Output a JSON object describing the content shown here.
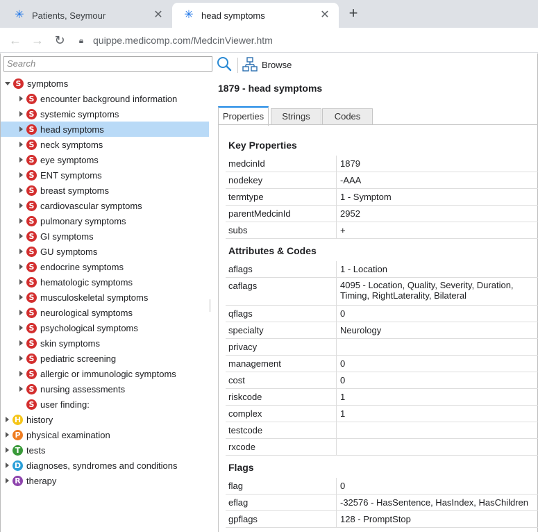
{
  "browser": {
    "tabs": [
      {
        "title": "Patients, Seymour",
        "icon": "medicomp-icon"
      },
      {
        "title": "head symptoms",
        "icon": "medicomp-icon"
      }
    ],
    "url": "quippe.medicomp.com/MedcinViewer.htm"
  },
  "search": {
    "placeholder": "Search"
  },
  "toolbar": {
    "browse_label": "Browse"
  },
  "tree": [
    {
      "label": "symptoms",
      "badge": "S",
      "color": "#d32f2f",
      "level": 0,
      "toggle": "down"
    },
    {
      "label": "encounter background information",
      "badge": "S",
      "color": "#d32f2f",
      "level": 1,
      "toggle": "right"
    },
    {
      "label": "systemic symptoms",
      "badge": "S",
      "color": "#d32f2f",
      "level": 1,
      "toggle": "right"
    },
    {
      "label": "head symptoms",
      "badge": "S",
      "color": "#d32f2f",
      "level": 1,
      "toggle": "right",
      "selected": true
    },
    {
      "label": "neck symptoms",
      "badge": "S",
      "color": "#d32f2f",
      "level": 1,
      "toggle": "right"
    },
    {
      "label": "eye symptoms",
      "badge": "S",
      "color": "#d32f2f",
      "level": 1,
      "toggle": "right"
    },
    {
      "label": "ENT symptoms",
      "badge": "S",
      "color": "#d32f2f",
      "level": 1,
      "toggle": "right"
    },
    {
      "label": "breast symptoms",
      "badge": "S",
      "color": "#d32f2f",
      "level": 1,
      "toggle": "right"
    },
    {
      "label": "cardiovascular symptoms",
      "badge": "S",
      "color": "#d32f2f",
      "level": 1,
      "toggle": "right"
    },
    {
      "label": "pulmonary symptoms",
      "badge": "S",
      "color": "#d32f2f",
      "level": 1,
      "toggle": "right"
    },
    {
      "label": "GI symptoms",
      "badge": "S",
      "color": "#d32f2f",
      "level": 1,
      "toggle": "right"
    },
    {
      "label": "GU symptoms",
      "badge": "S",
      "color": "#d32f2f",
      "level": 1,
      "toggle": "right"
    },
    {
      "label": "endocrine symptoms",
      "badge": "S",
      "color": "#d32f2f",
      "level": 1,
      "toggle": "right"
    },
    {
      "label": "hematologic symptoms",
      "badge": "S",
      "color": "#d32f2f",
      "level": 1,
      "toggle": "right"
    },
    {
      "label": "musculoskeletal symptoms",
      "badge": "S",
      "color": "#d32f2f",
      "level": 1,
      "toggle": "right"
    },
    {
      "label": "neurological symptoms",
      "badge": "S",
      "color": "#d32f2f",
      "level": 1,
      "toggle": "right"
    },
    {
      "label": "psychological symptoms",
      "badge": "S",
      "color": "#d32f2f",
      "level": 1,
      "toggle": "right"
    },
    {
      "label": "skin symptoms",
      "badge": "S",
      "color": "#d32f2f",
      "level": 1,
      "toggle": "right"
    },
    {
      "label": "pediatric screening",
      "badge": "S",
      "color": "#d32f2f",
      "level": 1,
      "toggle": "right"
    },
    {
      "label": "allergic or immunologic symptoms",
      "badge": "S",
      "color": "#d32f2f",
      "level": 1,
      "toggle": "right"
    },
    {
      "label": "nursing assessments",
      "badge": "S",
      "color": "#d32f2f",
      "level": 1,
      "toggle": "right"
    },
    {
      "label": "user finding:",
      "badge": "S",
      "color": "#d32f2f",
      "level": 1,
      "toggle": "none"
    },
    {
      "label": "history",
      "badge": "H",
      "color": "#f5c518",
      "level": 0,
      "toggle": "right"
    },
    {
      "label": "physical examination",
      "badge": "P",
      "color": "#ef7d22",
      "level": 0,
      "toggle": "right"
    },
    {
      "label": "tests",
      "badge": "T",
      "color": "#3a9a3a",
      "level": 0,
      "toggle": "right"
    },
    {
      "label": "diagnoses, syndromes and conditions",
      "badge": "D",
      "color": "#2b9fd8",
      "level": 0,
      "toggle": "right"
    },
    {
      "label": "therapy",
      "badge": "R",
      "color": "#8e44ad",
      "level": 0,
      "toggle": "right"
    }
  ],
  "detail": {
    "title": "1879 - head symptoms",
    "tabs": [
      "Properties",
      "Strings",
      "Codes"
    ],
    "active_tab": "Properties",
    "sections": [
      {
        "heading": "Key Properties",
        "rows": [
          {
            "key": "medcinId",
            "value": "1879"
          },
          {
            "key": "nodekey",
            "value": "-AAA"
          },
          {
            "key": "termtype",
            "value": "1 - Symptom"
          },
          {
            "key": "parentMedcinId",
            "value": "2952"
          },
          {
            "key": "subs",
            "value": "+"
          }
        ]
      },
      {
        "heading": "Attributes & Codes",
        "rows": [
          {
            "key": "aflags",
            "value": "1 - Location"
          },
          {
            "key": "caflags",
            "value": "4095 - Location, Quality, Severity, Duration, Timing, RightLaterality, Bilateral",
            "tall": true
          },
          {
            "key": "qflags",
            "value": "0"
          },
          {
            "key": "specialty",
            "value": "Neurology"
          },
          {
            "key": "privacy",
            "value": ""
          },
          {
            "key": "management",
            "value": "0"
          },
          {
            "key": "cost",
            "value": "0"
          },
          {
            "key": "riskcode",
            "value": "1"
          },
          {
            "key": "complex",
            "value": "1"
          },
          {
            "key": "testcode",
            "value": ""
          },
          {
            "key": "rxcode",
            "value": ""
          }
        ]
      },
      {
        "heading": "Flags",
        "rows": [
          {
            "key": "flag",
            "value": "0"
          },
          {
            "key": "eflag",
            "value": "-32576 - HasSentence, HasIndex, HasChildren"
          },
          {
            "key": "gpflags",
            "value": "128 - PromptStop"
          }
        ]
      }
    ]
  }
}
